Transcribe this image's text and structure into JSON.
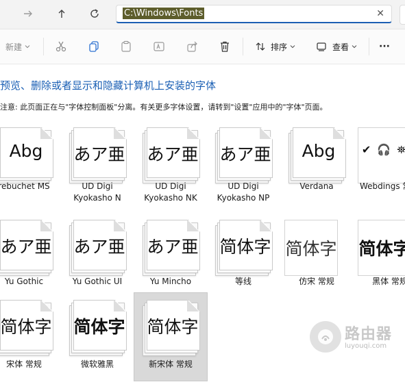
{
  "address_bar": {
    "path": "C:\\Windows\\Fonts",
    "clear_glyph": "✕"
  },
  "nav": {
    "forward_icon": "arrow-right-icon",
    "up_icon": "arrow-up-icon",
    "refresh_icon": "refresh-icon"
  },
  "toolbar": {
    "new_label": "新建",
    "sort_label": "排序",
    "view_label": "查看",
    "more_label": "···"
  },
  "heading": "预览、删除或者显示和隐藏计算机上安装的字体",
  "note": "注意: 此页面正在与\"字体控制面板\"分离。有关更多字体设置，请转到\"设置\"应用中的\"字体\"页面。",
  "fonts": [
    {
      "sample": "Abg",
      "name_line1": "rebuchet MS",
      "name_line2": ""
    },
    {
      "sample": "あア亜",
      "name_line1": "UD Digi",
      "name_line2": "Kyokasho N"
    },
    {
      "sample": "あア亜",
      "name_line1": "UD Digi",
      "name_line2": "Kyokasho NK"
    },
    {
      "sample": "あア亜",
      "name_line1": "UD Digi",
      "name_line2": "Kyokasho NP"
    },
    {
      "sample": "Abg",
      "name_line1": "Verdana",
      "name_line2": ""
    },
    {
      "sample": "✔ 🎧 ⛯",
      "name_line1": "Webdings 常规",
      "name_line2": ""
    },
    {
      "sample": "あア亜",
      "name_line1": "Yu Gothic",
      "name_line2": ""
    },
    {
      "sample": "あア亜",
      "name_line1": "Yu Gothic UI",
      "name_line2": ""
    },
    {
      "sample": "あア亜",
      "name_line1": "Yu Mincho",
      "name_line2": ""
    },
    {
      "sample": "简体字",
      "name_line1": "等线",
      "name_line2": ""
    },
    {
      "sample": "简体字",
      "name_line1": "仿宋 常规",
      "name_line2": ""
    },
    {
      "sample": "简体字",
      "name_line1": "黑体 常规",
      "name_line2": ""
    },
    {
      "sample": "简体字",
      "name_line1": "宋体 常规",
      "name_line2": ""
    },
    {
      "sample": "简体字",
      "name_line1": "微软雅黑",
      "name_line2": ""
    },
    {
      "sample": "简体字",
      "name_line1": "新宋体 常规",
      "name_line2": ""
    }
  ],
  "watermark": {
    "title": "路由器",
    "url": "luyouqi.com"
  }
}
